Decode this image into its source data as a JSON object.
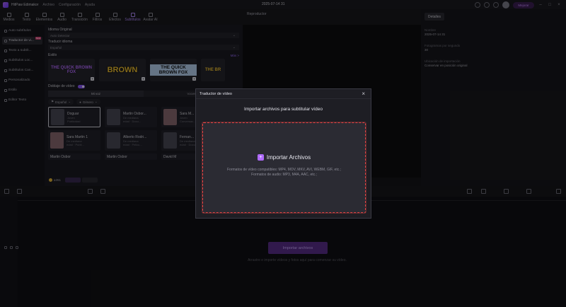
{
  "titlebar": {
    "app_name": "HitPaw Edimakor",
    "menu": [
      "Archivo",
      "Configuración",
      "Ayuda"
    ],
    "project_title": "2025-07-14 31",
    "upgrade_label": "Mejorar"
  },
  "toolbar": {
    "items": [
      "Medios",
      "Texto",
      "Elementos",
      "Audio",
      "Transición",
      "Filtros",
      "Efectos",
      "Subtítulos",
      "Avatar AI"
    ],
    "active": "Subtítulos"
  },
  "leftnav": {
    "items": [
      "Auto subtítulos",
      "Traductor de vi...",
      "Texto a subtít...",
      "Subtítulos Loc...",
      "Subtítulos Can...",
      "Personalizado",
      "Estilo",
      "Editor Texto"
    ],
    "badge": "New"
  },
  "panel": {
    "original_label": "Idioma Original",
    "original_value": "Auto Detectar",
    "translate_label": "Traducir idioma",
    "translate_value": "Español",
    "style_label": "Estilo",
    "more_label": "Más >",
    "styles": [
      "THE QUICK BROWN FOX",
      "BROWN",
      "THE QUICK BROWN FOX",
      "THE BR"
    ],
    "dub_label": "Doblaje de vídeo",
    "voice_tabs": [
      "Mi voz",
      "Voces"
    ],
    "filter_lang": "Español",
    "filter_gender": "Género",
    "voices": [
      {
        "name": "Doguar",
        "desc1": "Joven",
        "desc2": "Publicidad"
      },
      {
        "name": "Martin Osbor...",
        "desc1": "De mediana",
        "desc2": "edad · Docu..."
      },
      {
        "name": "Sara M...",
        "desc1": "Joven",
        "desc2": "Conversac..."
      },
      {
        "name": "Sara Martin 1",
        "desc1": "De mediana",
        "desc2": "edad · Publi..."
      },
      {
        "name": "Alberto Rodri...",
        "desc1": "De mediana",
        "desc2": "edad · Pelicu..."
      },
      {
        "name": "Fernan...",
        "desc1": "De mediana",
        "desc2": "edad · Docu..."
      },
      {
        "name": "Martin Osbor",
        "desc1": "",
        "desc2": ""
      },
      {
        "name": "Martin Osbor",
        "desc1": "",
        "desc2": ""
      },
      {
        "name": "David M",
        "desc1": "",
        "desc2": ""
      }
    ],
    "credits": "≥261"
  },
  "player": {
    "title": "Reproductor"
  },
  "details": {
    "tab": "Detalles",
    "fields": [
      {
        "label": "Nombre",
        "value": "2025-07-14 31"
      },
      {
        "label": "Fotogramas por segundo",
        "value": "30"
      },
      {
        "label": "Ubicación de importación",
        "value": "Conservar en posición original"
      }
    ]
  },
  "timeline": {
    "import_button": "Importar archivos",
    "import_hint": "Arrastre e importe vídeos y fotos aquí para comenzar su vídeo."
  },
  "modal": {
    "title": "Traductor de vídeo",
    "subtitle": "Importar archivos para subtitular vídeo",
    "import_label": "Importar Archivos",
    "video_formats": "Formatos de vídeo compatibles: MP4, MOV, MKV, AVI, WEBM, GIF, etc.;",
    "audio_formats": "Formatos de audio: MP3, M4A, AAC, etc.;"
  }
}
